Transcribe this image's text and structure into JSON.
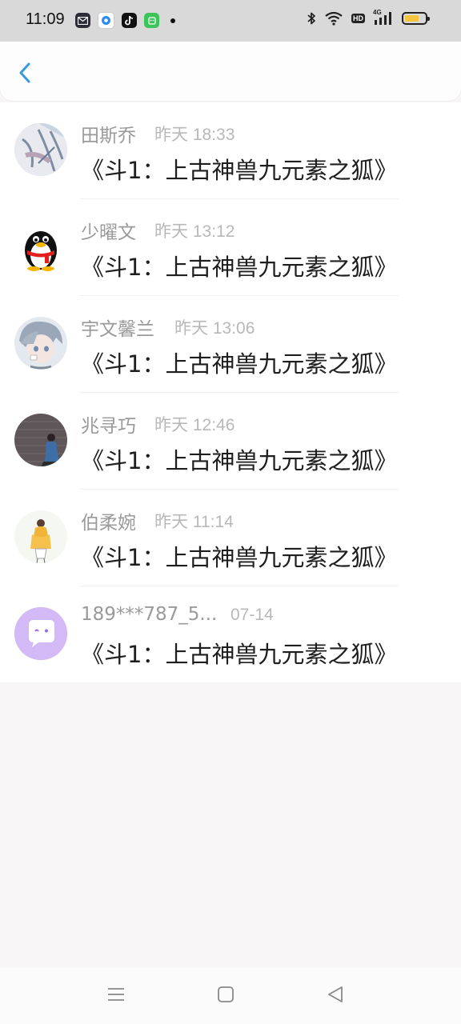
{
  "status_bar": {
    "time": "11:09",
    "app_icons": [
      "mail-app-icon",
      "browser-app-icon",
      "tiktok-app-icon",
      "wechat-app-icon"
    ],
    "hd_badge": "HD",
    "network": "4G",
    "battery_level": 0.7,
    "battery_color": "#f4c53d"
  },
  "header": {
    "back_icon": "chevron-left-icon",
    "accent": "#3a9ae0"
  },
  "messages": [
    {
      "name": "田斯乔",
      "time": "昨天 18:33",
      "text": "《斗1：上古神兽九元素之狐》",
      "avatar": "anime-sketch-avatar"
    },
    {
      "name": "少曜文",
      "time": "昨天 13:12",
      "text": "《斗1：上古神兽九元素之狐》",
      "avatar": "qq-penguin-avatar"
    },
    {
      "name": "宇文馨兰",
      "time": "昨天 13:06",
      "text": "《斗1：上古神兽九元素之狐》",
      "avatar": "anime-boy-avatar"
    },
    {
      "name": "兆寻巧",
      "time": "昨天 12:46",
      "text": "《斗1：上古神兽九元素之狐》",
      "avatar": "brick-wall-girl-avatar"
    },
    {
      "name": "伯柔婉",
      "time": "昨天 11:14",
      "text": "《斗1：上古神兽九元素之狐》",
      "avatar": "illustrated-girl-avatar"
    },
    {
      "name": "189***787_5...",
      "time": "07-14",
      "text": "《斗1：上古神兽九元素之狐》",
      "avatar": "chat-bubble-default-avatar"
    }
  ],
  "nav_bar": {
    "icons": [
      "menu-icon",
      "home-square-icon",
      "back-triangle-icon"
    ]
  }
}
